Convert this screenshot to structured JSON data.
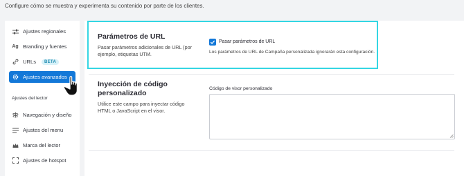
{
  "intro": "Configure cómo se muestra y experimenta su contenido por parte de los clientes.",
  "sidebar": {
    "items": [
      {
        "label": "Ajustes regionales",
        "icon": "sliders-icon"
      },
      {
        "label": "Branding y fuentes",
        "icon": "typography-icon"
      },
      {
        "label": "URLs",
        "icon": "link-icon",
        "badge": "BETA"
      },
      {
        "label": "Ajustes avanzados",
        "icon": "gear-icon",
        "active": true
      }
    ],
    "section_label": "Ajustes del lector",
    "reader_items": [
      {
        "label": "Navegación y diseño",
        "icon": "navigation-icon"
      },
      {
        "label": "Ajustes del menu",
        "icon": "menu-icon"
      },
      {
        "label": "Marca del lector",
        "icon": "crown-icon"
      },
      {
        "label": "Ajustes de hotspot",
        "icon": "hotspot-icon"
      }
    ]
  },
  "url_params": {
    "title": "Parámetros de URL",
    "description": "Pasar parámetros adicionales de URL (por ejemplo, etiquetas UTM.",
    "checkbox_label": "Pasar parámetros de URL",
    "checked": true,
    "note": "Los parámetros de URL de Campaña personalizada ignorarán esta configuración."
  },
  "code_injection": {
    "title": "Inyección de código personalizado",
    "description": "Utilice este campo para inyectar código HTML o JavaScript en el visor.",
    "field_label": "Código de visor personalizado",
    "value": ""
  },
  "colors": {
    "accent": "#1378d8",
    "highlight": "#34d6e3",
    "badge_bg": "#d7f1f8"
  }
}
